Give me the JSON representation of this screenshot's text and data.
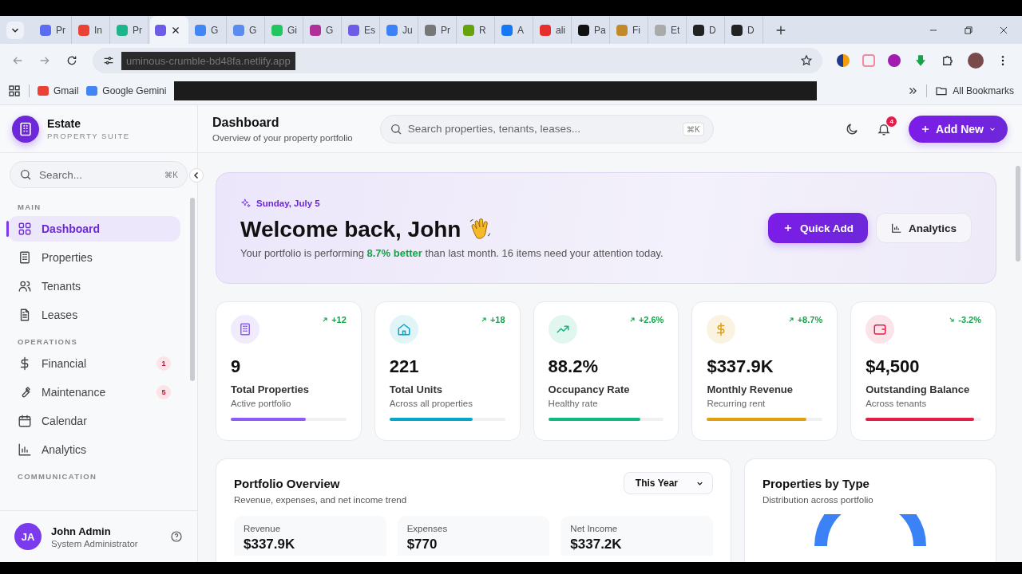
{
  "browser": {
    "tabs": [
      {
        "title": "Pr",
        "color": "#5b6cf0",
        "selected": false
      },
      {
        "title": "In",
        "color": "#ea4335",
        "selected": false
      },
      {
        "title": "Pr",
        "color": "#1fb58a",
        "selected": false
      },
      {
        "color": "#6d5ce8",
        "selected": true
      },
      {
        "title": "G",
        "color": "#4285f4",
        "selected": false
      },
      {
        "title": "G",
        "color": "#5a8cf0",
        "selected": false
      },
      {
        "title": "Gi",
        "color": "#22c55e",
        "selected": false
      },
      {
        "title": "G",
        "color": "#b0309a",
        "selected": false
      },
      {
        "title": "Es",
        "color": "#6d5ce8",
        "selected": false
      },
      {
        "title": "Ju",
        "color": "#3b82f6",
        "selected": false
      },
      {
        "title": "Pr",
        "color": "#777777",
        "selected": false
      },
      {
        "title": "R",
        "color": "#65a30d",
        "selected": false
      },
      {
        "title": "A",
        "color": "#1877f2",
        "selected": false
      },
      {
        "title": "ali",
        "color": "#e62e2e",
        "selected": false
      },
      {
        "title": "Pa",
        "color": "#111111",
        "selected": false
      },
      {
        "title": "Fi",
        "color": "#c08a2a",
        "selected": false
      },
      {
        "title": "Et",
        "color": "#aaaaaa",
        "selected": false
      },
      {
        "title": "D",
        "color": "#222222",
        "selected": false
      },
      {
        "title": "D",
        "color": "#222222",
        "selected": false
      }
    ],
    "url": "uminous-crumble-bd48fa.netlify.app",
    "bookmarks": [
      {
        "label": "Gmail",
        "color": "#ea4335"
      },
      {
        "label": "Google Gemini",
        "color": "#4285f4"
      }
    ],
    "all_bookmarks": "All Bookmarks"
  },
  "sidebar": {
    "brand": "Estate",
    "tagline": "PROPERTY SUITE",
    "search": {
      "placeholder": "Search...",
      "shortcut": "⌘K"
    },
    "sections": [
      {
        "title": "MAIN",
        "items": [
          {
            "label": "Dashboard",
            "selected": true
          },
          {
            "label": "Properties",
            "selected": false
          },
          {
            "label": "Tenants",
            "selected": false
          },
          {
            "label": "Leases",
            "selected": false
          }
        ]
      },
      {
        "title": "OPERATIONS",
        "items": [
          {
            "label": "Financial",
            "selected": false,
            "badge": "1"
          },
          {
            "label": "Maintenance",
            "selected": false,
            "badge": "5"
          },
          {
            "label": "Calendar",
            "selected": false
          },
          {
            "label": "Analytics",
            "selected": false
          }
        ]
      },
      {
        "title": "COMMUNICATION"
      }
    ],
    "user": {
      "initials": "JA",
      "name": "John Admin",
      "role": "System Administrator"
    }
  },
  "header": {
    "title": "Dashboard",
    "subtitle": "Overview of your property portfolio",
    "search": {
      "placeholder": "Search properties, tenants, leases...",
      "shortcut": "⌘K"
    },
    "notifications": "4",
    "add_button": "Add New"
  },
  "welcome": {
    "date": "Sunday, July 5",
    "title": "Welcome back, John",
    "message": "Your portfolio is performing **8.7% better** than last month. 16 items need your attention today.",
    "buttons": [
      {
        "label": "Quick Add",
        "kind": "primary"
      },
      {
        "label": "Analytics",
        "kind": "secondary"
      }
    ]
  },
  "stats": [
    {
      "color": "#8b5cf6",
      "trend": "+12",
      "kind": "rise",
      "value": "9",
      "label": "Total Properties",
      "sub": "Active portfolio",
      "level": 0.65
    },
    {
      "color": "#06a6c9",
      "trend": "+18",
      "kind": "rise",
      "value": "221",
      "label": "Total Units",
      "sub": "Across all properties",
      "level": 0.72
    },
    {
      "color": "#10b981",
      "trend": "+2.6%",
      "kind": "rise",
      "value": "88.2%",
      "label": "Occupancy Rate",
      "sub": "Healthy rate",
      "level": 0.8
    },
    {
      "color": "#e0a010",
      "trend": "+8.7%",
      "kind": "rise",
      "value": "$337.9K",
      "label": "Monthly Revenue",
      "sub": "Recurring rent",
      "level": 0.86
    },
    {
      "color": "#e11d48",
      "trend": "-3.2%",
      "kind": "fall",
      "value": "$4,500",
      "label": "Outstanding Balance",
      "sub": "Across tenants",
      "level": 0.94
    }
  ],
  "portfolio": {
    "title": "Portfolio Overview",
    "subtitle": "Revenue, expenses, and net income trend",
    "period": "This Year",
    "metrics": [
      {
        "label": "Revenue",
        "value": "$337.9K"
      },
      {
        "label": "Expenses",
        "value": "$770"
      },
      {
        "label": "Net Income",
        "value": "$337.2K"
      }
    ]
  },
  "by_type": {
    "title": "Properties by Type",
    "subtitle": "Distribution across portfolio"
  }
}
